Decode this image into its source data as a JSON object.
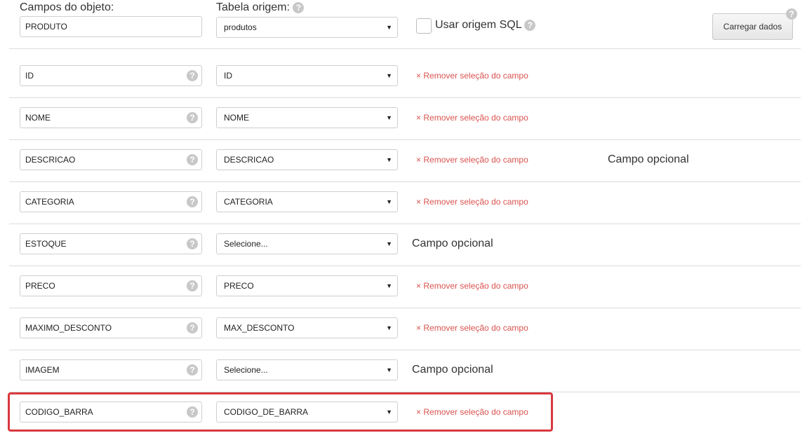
{
  "header": {
    "object_fields_label": "Campos do objeto:",
    "source_table_label": "Tabela origem:",
    "object_name_value": "PRODUTO",
    "source_table_value": "produtos",
    "use_sql_label": "Usar origem SQL",
    "load_button_label": "Carregar dados"
  },
  "icons": {
    "help": "question-mark",
    "caret": "triangle-down"
  },
  "remove_label": "Remover seleção do campo",
  "optional_label": "Campo opcional",
  "remove_prefix": "×",
  "help_glyph": "?",
  "caret_glyph": "▼",
  "rows": [
    {
      "field": "ID",
      "source": "ID"
    },
    {
      "field": "NOME",
      "source": "NOME"
    },
    {
      "field": "DESCRICAO",
      "source": "DESCRICAO"
    },
    {
      "field": "CATEGORIA",
      "source": "CATEGORIA"
    },
    {
      "field": "ESTOQUE",
      "source": "Selecione..."
    },
    {
      "field": "PRECO",
      "source": "PRECO"
    },
    {
      "field": "MAXIMO_DESCONTO",
      "source": "MAX_DESCONTO"
    },
    {
      "field": "IMAGEM",
      "source": "Selecione..."
    },
    {
      "field": "CODIGO_BARRA",
      "source": "CODIGO_DE_BARRA"
    }
  ],
  "colors": {
    "remove_link": "#d9534f",
    "highlight_border": "#d9383e"
  }
}
